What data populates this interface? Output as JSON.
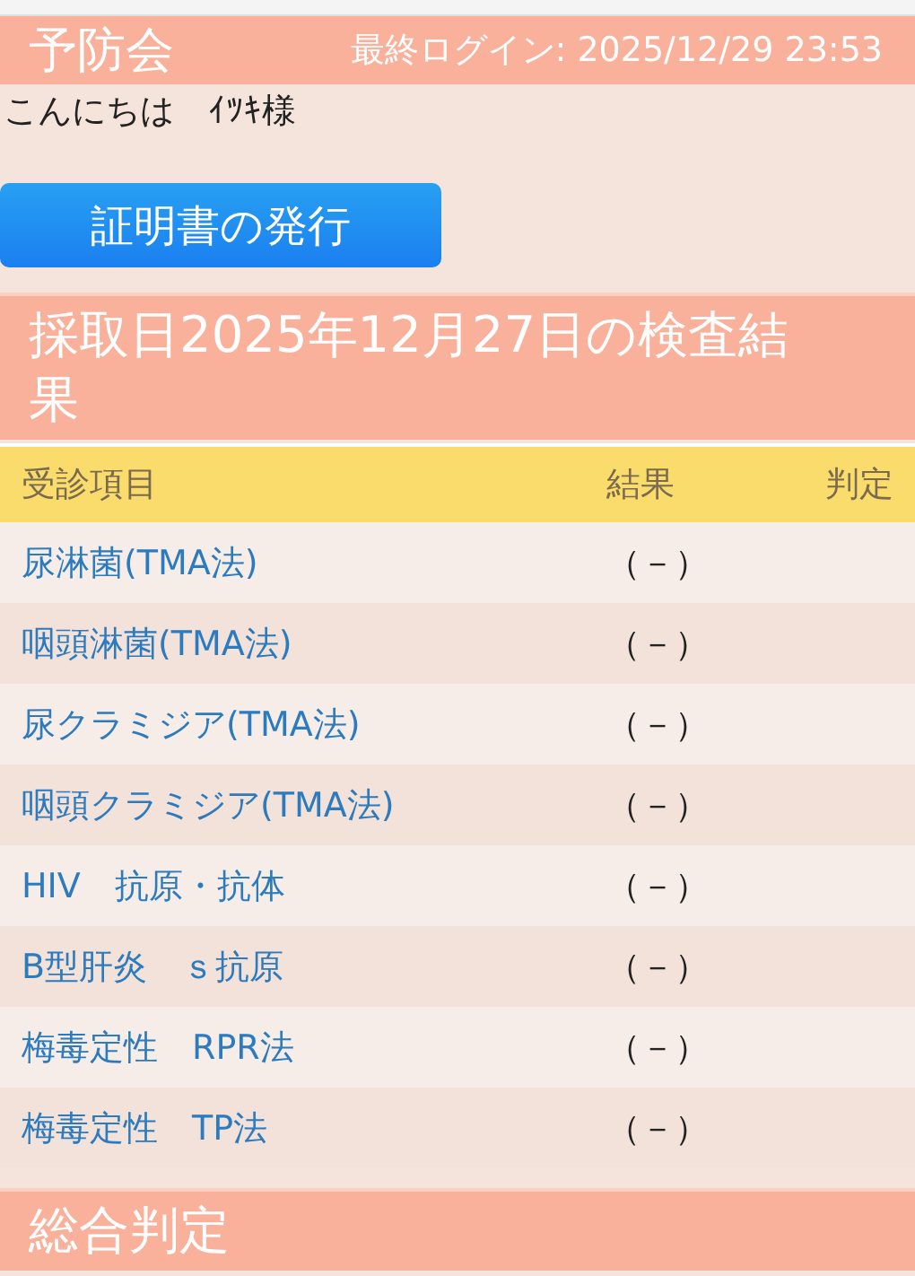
{
  "header": {
    "logo": "予防会",
    "last_login": "最終ログイン: 2025/12/29 23:53"
  },
  "greeting": "こんにちは　ｲﾂｷ様",
  "certificate_button": "証明書の発行",
  "results_title": "採取日2025年12月27日の検査結果",
  "table": {
    "columns": [
      "受診項目",
      "結果",
      "判定"
    ],
    "rows": [
      {
        "item": "尿淋菌(TMA法)",
        "result": "（－）"
      },
      {
        "item": "咽頭淋菌(TMA法)",
        "result": "（－）"
      },
      {
        "item": "尿クラミジア(TMA法)",
        "result": "（－）"
      },
      {
        "item": "咽頭クラミジア(TMA法)",
        "result": "（－）"
      },
      {
        "item": "HIV　抗原・抗体",
        "result": "（－）"
      },
      {
        "item": "B型肝炎　ｓ抗原",
        "result": "（－）"
      },
      {
        "item": "梅毒定性　RPR法",
        "result": "（－）"
      },
      {
        "item": "梅毒定性　TP法",
        "result": "（－）"
      }
    ]
  },
  "summary_title": "総合判定"
}
